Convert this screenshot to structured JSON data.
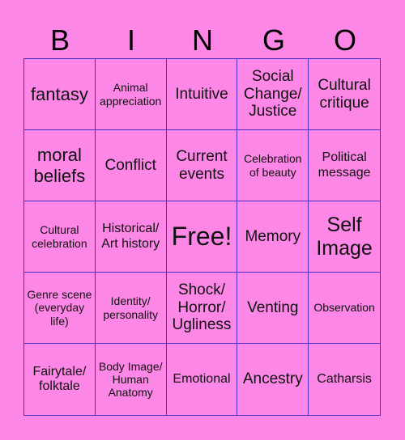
{
  "header": [
    "B",
    "I",
    "N",
    "G",
    "O"
  ],
  "cells": [
    {
      "text": "fantasy",
      "size": "s4"
    },
    {
      "text": "Animal appreciation",
      "size": "s1"
    },
    {
      "text": "Intuitive",
      "size": "s3"
    },
    {
      "text": "Social Change/ Justice",
      "size": "s3"
    },
    {
      "text": "Cultural critique",
      "size": "s3"
    },
    {
      "text": "moral beliefs",
      "size": "s4"
    },
    {
      "text": "Conflict",
      "size": "s3"
    },
    {
      "text": "Current events",
      "size": "s3"
    },
    {
      "text": "Celebration of beauty",
      "size": "s1"
    },
    {
      "text": "Political message",
      "size": "s2"
    },
    {
      "text": "Cultural celebration",
      "size": "s1"
    },
    {
      "text": "Historical/ Art history",
      "size": "s2"
    },
    {
      "text": "Free!",
      "size": "s6"
    },
    {
      "text": "Memory",
      "size": "s3"
    },
    {
      "text": "Self Image",
      "size": "s5"
    },
    {
      "text": "Genre scene (everyday life)",
      "size": "s1"
    },
    {
      "text": "Identity/ personality",
      "size": "s1"
    },
    {
      "text": "Shock/ Horror/ Ugliness",
      "size": "s3"
    },
    {
      "text": "Venting",
      "size": "s3"
    },
    {
      "text": "Observation",
      "size": "s1"
    },
    {
      "text": "Fairytale/ folktale",
      "size": "s2"
    },
    {
      "text": "Body Image/ Human Anatomy",
      "size": "s1"
    },
    {
      "text": "Emotional",
      "size": "s2"
    },
    {
      "text": "Ancestry",
      "size": "s3"
    },
    {
      "text": "Catharsis",
      "size": "s2"
    }
  ]
}
